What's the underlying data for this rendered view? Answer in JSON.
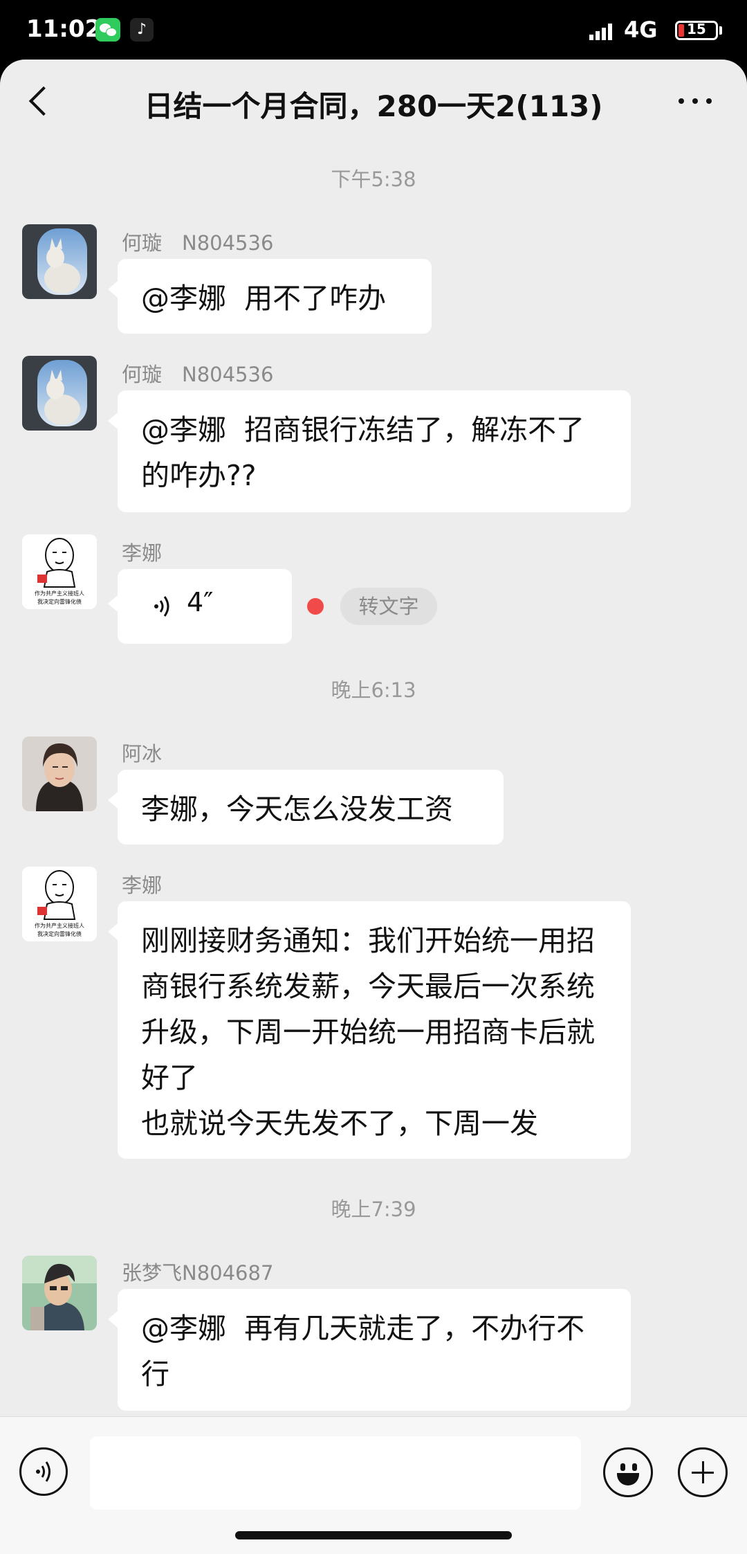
{
  "status_bar": {
    "time": "11:02",
    "network": "4G",
    "battery": "15"
  },
  "header": {
    "title": "日结一个月合同，280一天2(113)"
  },
  "messages": [
    {
      "type": "timestamp",
      "text": "下午5:38"
    },
    {
      "type": "text",
      "sender": "何璇　N804536",
      "text": "@李娜  用不了咋办"
    },
    {
      "type": "text",
      "sender": "何璇　N804536",
      "text": "@李娜  招商银行冻结了，解冻不了的咋办??"
    },
    {
      "type": "voice",
      "sender": "李娜",
      "duration": "4″",
      "action": "转文字"
    },
    {
      "type": "timestamp",
      "text": "晚上6:13"
    },
    {
      "type": "text",
      "sender": "阿冰",
      "text": "李娜，今天怎么没发工资"
    },
    {
      "type": "text",
      "sender": "李娜",
      "text": "刚刚接财务通知：我们开始统一用招商银行系统发薪，今天最后一次系统升级，下周一开始统一用招商卡后就好了\n也就说今天先发不了，下周一发"
    },
    {
      "type": "timestamp",
      "text": "晚上7:39"
    },
    {
      "type": "text",
      "sender": "张梦飞N804687",
      "text": "@李娜  再有几天就走了，不办行不行"
    }
  ],
  "meme_caption": "作为共产主义接班人 我决定向雷锋化债",
  "input_bar": {
    "placeholder": ""
  }
}
